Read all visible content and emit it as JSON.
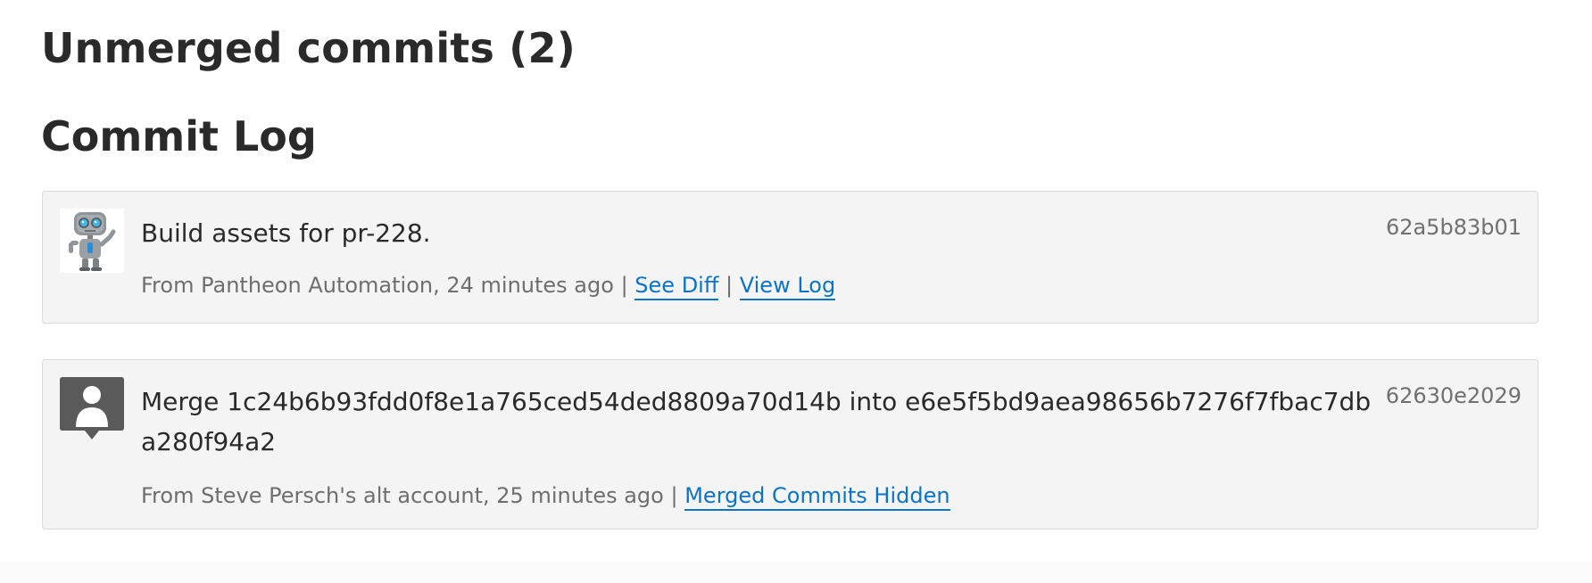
{
  "headings": {
    "unmerged": "Unmerged commits (2)",
    "log": "Commit Log"
  },
  "commits": [
    {
      "message": "Build assets for pr-228.",
      "meta_prefix": "From Pantheon Automation, 24 minutes ago",
      "separator": "|",
      "links": [
        "See Diff",
        "View Log"
      ],
      "hash": "62a5b83b01",
      "avatar": "robot-avatar"
    },
    {
      "message": "Merge 1c24b6b93fdd0f8e1a765ced54ded8809a70d14b into e6e5f5bd9aea98656b7276f7fbac7dba280f94a2",
      "meta_prefix": "From Steve Persch's alt account, 25 minutes ago",
      "separator": "|",
      "links": [
        "Merged Commits Hidden"
      ],
      "hash": "62630e2029",
      "avatar": "default-user-avatar"
    }
  ],
  "colors": {
    "link": "#0b74c8",
    "card_bg": "#f4f4f4",
    "card_border": "#d9d9d9",
    "meta_text": "#6e6e6e"
  }
}
